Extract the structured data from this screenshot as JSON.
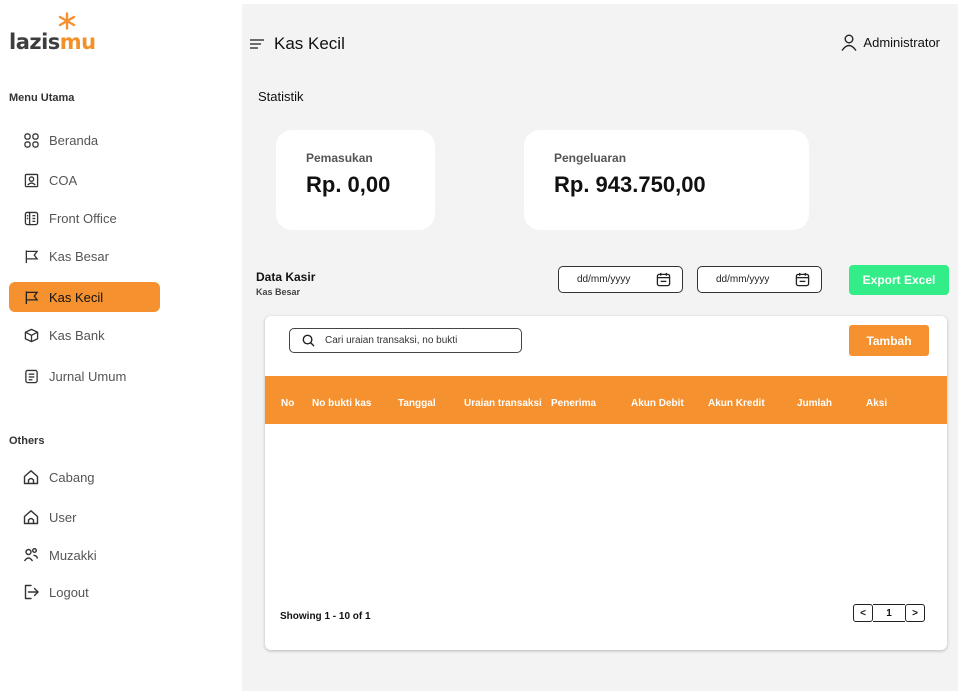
{
  "logo": {
    "part1": "lazis",
    "part2": "mu"
  },
  "sidebar": {
    "section_main": "Menu Utama",
    "items": [
      {
        "label": "Beranda",
        "icon": "grid-icon"
      },
      {
        "label": "COA",
        "icon": "id-card-icon"
      },
      {
        "label": "Front Office",
        "icon": "building-icon"
      },
      {
        "label": "Kas Besar",
        "icon": "flag-icon"
      },
      {
        "label": "Kas Kecil",
        "icon": "flag-icon",
        "active": true
      },
      {
        "label": "Kas Bank",
        "icon": "cube-icon"
      },
      {
        "label": "Jurnal Umum",
        "icon": "document-icon"
      }
    ],
    "section_others": "Others",
    "others": [
      {
        "label": "Cabang",
        "icon": "home-icon"
      },
      {
        "label": "User",
        "icon": "home-icon"
      },
      {
        "label": "Muzakki",
        "icon": "users-icon"
      },
      {
        "label": "Logout",
        "icon": "logout-icon"
      }
    ]
  },
  "header": {
    "title": "Kas Kecil",
    "user": "Administrator"
  },
  "stats": {
    "label": "Statistik",
    "income_label": "Pemasukan",
    "income_value": "Rp. 0,00",
    "expense_label": "Pengeluaran",
    "expense_value": "Rp. 943.750,00"
  },
  "data_kasir": {
    "title": "Data Kasir",
    "subtitle": "Kas Besar",
    "date_from_placeholder": "dd/mm/yyyy",
    "date_to_placeholder": "dd/mm/yyyy",
    "export_label": "Export Excel"
  },
  "table": {
    "search_placeholder": "Cari uraian transaksi, no bukti",
    "add_label": "Tambah",
    "columns": [
      "No",
      "No bukti kas",
      "Tanggal",
      "Uraian transaksi",
      "Penerima",
      "Akun Debit",
      "Akun Kredit",
      "Jumlah",
      "Aksi"
    ],
    "rows": [],
    "showing": "Showing 1 - 10 of 1",
    "pagination": {
      "prev": "<",
      "page": "1",
      "next": ">"
    }
  },
  "colors": {
    "accent": "#f5912e",
    "export": "#33ee88",
    "background": "#f3f3f3"
  }
}
